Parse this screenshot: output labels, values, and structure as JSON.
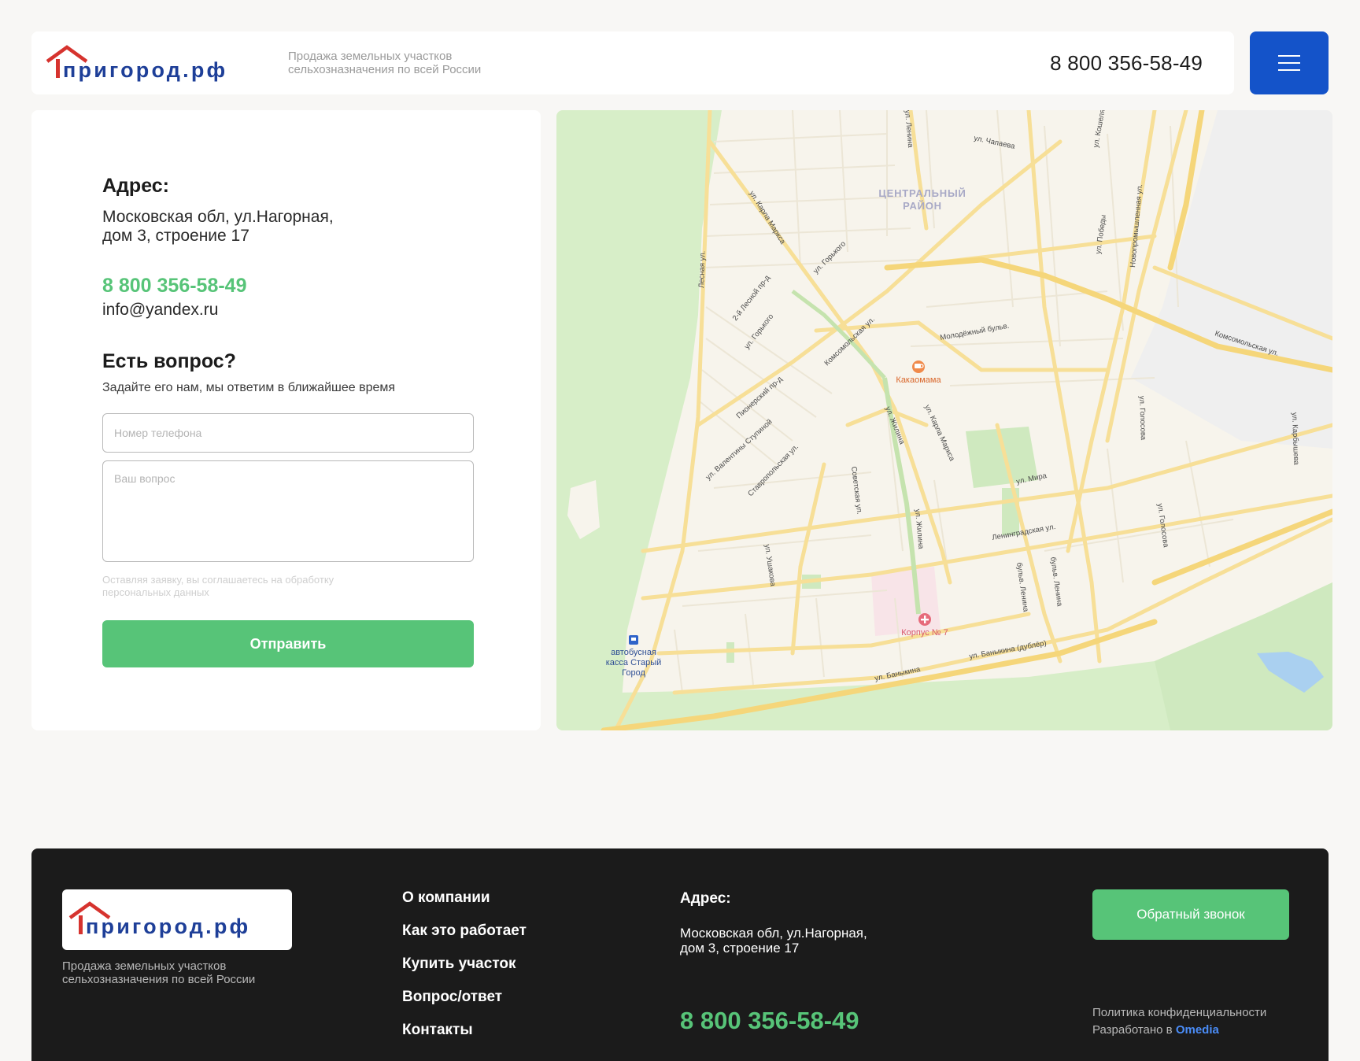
{
  "header": {
    "logo_text": "пригород.рф",
    "tagline_line1": "Продажа земельных участков",
    "tagline_line2": "сельхозназначения по всей России",
    "phone": "8 800 356-58-49",
    "menu_icon": "hamburger-icon"
  },
  "contact": {
    "address_title": "Адрес:",
    "address_line1": "Московская обл, ул.Нагорная,",
    "address_line2": "дом 3, строение 17",
    "phone": "8 800 356-58-49",
    "email": "info@yandex.ru",
    "question_title": "Есть вопрос?",
    "question_subtitle": "Задайте его нам, мы ответим в ближайшее время",
    "phone_placeholder": "Номер телефона",
    "question_placeholder": "Ваш вопрос",
    "consent_line1": "Оставляя заявку, вы соглашаетесь на обработку",
    "consent_line2": "персональных данных",
    "submit_label": "Отправить"
  },
  "map": {
    "district_line1": "ЦЕНТРАЛЬНЫЙ",
    "district_line2": "РАЙОН",
    "poi_cafe": "Какаомама",
    "poi_hospital": "Корпус № 7",
    "poi_bus_line1": "автобусная",
    "poi_bus_line2": "касса Старый",
    "poi_bus_line3": "Город",
    "streets": {
      "lenina_top": "ул. Ленина",
      "chapaeva": "ул. Чапаева",
      "koshelya": "ул. Кошеля",
      "karla_marksa_1": "ул. Карла Маркса",
      "lesnaya": "Лесная ул.",
      "gorkogo_1": "ул. Горького",
      "lesnoy_pr": "2-й Лесной пр-д",
      "gorkogo_2": "ул. Горького",
      "pobedy": "ул. Победы",
      "novopromyshlennaya": "Новопромышленная ул.",
      "komsomolskaya_1": "Комсомольская ул.",
      "molodezhny": "Молодёжный бульв.",
      "komsomolskaya_2": "Комсомольская ул.",
      "pionersky": "Пионерский пр-д",
      "zhilina_1": "ул. Жилина",
      "karla_marksa_2": "ул. Карла Маркса",
      "golosova_1": "ул. Голосова",
      "karbysheva": "ул. Карбышева",
      "valentiny_stupinoy": "ул. Валентины Ступиной",
      "stavropolskaya": "Ставропольская ул.",
      "sovetskaya": "Советская ул.",
      "mira": "ул. Мира",
      "zhilina_2": "ул. Жилина",
      "leningradskaya": "Ленинградская ул.",
      "golosova_2": "ул. Голосова",
      "ushakova": "ул. Ушакова",
      "bulv_lenina_1": "бульв. Ленина",
      "bulv_lenina_2": "бульв. Ленина",
      "banykina_dubler": "ул. Баныкина (дублёр)",
      "banykina": "ул. Баныкина"
    }
  },
  "footer": {
    "logo_text": "пригород.рф",
    "tagline_line1": "Продажа земельных участков",
    "tagline_line2": "сельхозназначения по всей России",
    "nav": [
      "О компании",
      "Как это работает",
      "Купить участок",
      "Вопрос/ответ",
      "Контакты"
    ],
    "address_title": "Адрес:",
    "address_line1": "Московская обл, ул.Нагорная,",
    "address_line2": "дом 3, строение 17",
    "phone": "8 800 356-58-49",
    "callback_label": "Обратный звонок",
    "policy": "Политика конфиденциальности",
    "dev_prefix": "Разработано в",
    "dev_name": "Omedia"
  },
  "colors": {
    "brand_blue": "#1453c9",
    "brand_red": "#d6332e",
    "accent_green": "#57c478",
    "footer_bg": "#1b1b1b",
    "page_bg": "#f8f7f5"
  }
}
